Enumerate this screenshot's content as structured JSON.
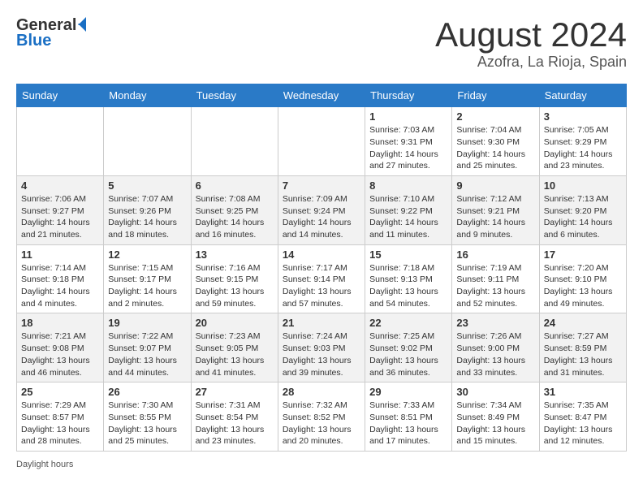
{
  "header": {
    "logo_general": "General",
    "logo_blue": "Blue",
    "month_year": "August 2024",
    "location": "Azofra, La Rioja, Spain"
  },
  "days_of_week": [
    "Sunday",
    "Monday",
    "Tuesday",
    "Wednesday",
    "Thursday",
    "Friday",
    "Saturday"
  ],
  "weeks": [
    [
      {
        "day": "",
        "info": ""
      },
      {
        "day": "",
        "info": ""
      },
      {
        "day": "",
        "info": ""
      },
      {
        "day": "",
        "info": ""
      },
      {
        "day": "1",
        "info": "Sunrise: 7:03 AM\nSunset: 9:31 PM\nDaylight: 14 hours and 27 minutes."
      },
      {
        "day": "2",
        "info": "Sunrise: 7:04 AM\nSunset: 9:30 PM\nDaylight: 14 hours and 25 minutes."
      },
      {
        "day": "3",
        "info": "Sunrise: 7:05 AM\nSunset: 9:29 PM\nDaylight: 14 hours and 23 minutes."
      }
    ],
    [
      {
        "day": "4",
        "info": "Sunrise: 7:06 AM\nSunset: 9:27 PM\nDaylight: 14 hours and 21 minutes."
      },
      {
        "day": "5",
        "info": "Sunrise: 7:07 AM\nSunset: 9:26 PM\nDaylight: 14 hours and 18 minutes."
      },
      {
        "day": "6",
        "info": "Sunrise: 7:08 AM\nSunset: 9:25 PM\nDaylight: 14 hours and 16 minutes."
      },
      {
        "day": "7",
        "info": "Sunrise: 7:09 AM\nSunset: 9:24 PM\nDaylight: 14 hours and 14 minutes."
      },
      {
        "day": "8",
        "info": "Sunrise: 7:10 AM\nSunset: 9:22 PM\nDaylight: 14 hours and 11 minutes."
      },
      {
        "day": "9",
        "info": "Sunrise: 7:12 AM\nSunset: 9:21 PM\nDaylight: 14 hours and 9 minutes."
      },
      {
        "day": "10",
        "info": "Sunrise: 7:13 AM\nSunset: 9:20 PM\nDaylight: 14 hours and 6 minutes."
      }
    ],
    [
      {
        "day": "11",
        "info": "Sunrise: 7:14 AM\nSunset: 9:18 PM\nDaylight: 14 hours and 4 minutes."
      },
      {
        "day": "12",
        "info": "Sunrise: 7:15 AM\nSunset: 9:17 PM\nDaylight: 14 hours and 2 minutes."
      },
      {
        "day": "13",
        "info": "Sunrise: 7:16 AM\nSunset: 9:15 PM\nDaylight: 13 hours and 59 minutes."
      },
      {
        "day": "14",
        "info": "Sunrise: 7:17 AM\nSunset: 9:14 PM\nDaylight: 13 hours and 57 minutes."
      },
      {
        "day": "15",
        "info": "Sunrise: 7:18 AM\nSunset: 9:13 PM\nDaylight: 13 hours and 54 minutes."
      },
      {
        "day": "16",
        "info": "Sunrise: 7:19 AM\nSunset: 9:11 PM\nDaylight: 13 hours and 52 minutes."
      },
      {
        "day": "17",
        "info": "Sunrise: 7:20 AM\nSunset: 9:10 PM\nDaylight: 13 hours and 49 minutes."
      }
    ],
    [
      {
        "day": "18",
        "info": "Sunrise: 7:21 AM\nSunset: 9:08 PM\nDaylight: 13 hours and 46 minutes."
      },
      {
        "day": "19",
        "info": "Sunrise: 7:22 AM\nSunset: 9:07 PM\nDaylight: 13 hours and 44 minutes."
      },
      {
        "day": "20",
        "info": "Sunrise: 7:23 AM\nSunset: 9:05 PM\nDaylight: 13 hours and 41 minutes."
      },
      {
        "day": "21",
        "info": "Sunrise: 7:24 AM\nSunset: 9:03 PM\nDaylight: 13 hours and 39 minutes."
      },
      {
        "day": "22",
        "info": "Sunrise: 7:25 AM\nSunset: 9:02 PM\nDaylight: 13 hours and 36 minutes."
      },
      {
        "day": "23",
        "info": "Sunrise: 7:26 AM\nSunset: 9:00 PM\nDaylight: 13 hours and 33 minutes."
      },
      {
        "day": "24",
        "info": "Sunrise: 7:27 AM\nSunset: 8:59 PM\nDaylight: 13 hours and 31 minutes."
      }
    ],
    [
      {
        "day": "25",
        "info": "Sunrise: 7:29 AM\nSunset: 8:57 PM\nDaylight: 13 hours and 28 minutes."
      },
      {
        "day": "26",
        "info": "Sunrise: 7:30 AM\nSunset: 8:55 PM\nDaylight: 13 hours and 25 minutes."
      },
      {
        "day": "27",
        "info": "Sunrise: 7:31 AM\nSunset: 8:54 PM\nDaylight: 13 hours and 23 minutes."
      },
      {
        "day": "28",
        "info": "Sunrise: 7:32 AM\nSunset: 8:52 PM\nDaylight: 13 hours and 20 minutes."
      },
      {
        "day": "29",
        "info": "Sunrise: 7:33 AM\nSunset: 8:51 PM\nDaylight: 13 hours and 17 minutes."
      },
      {
        "day": "30",
        "info": "Sunrise: 7:34 AM\nSunset: 8:49 PM\nDaylight: 13 hours and 15 minutes."
      },
      {
        "day": "31",
        "info": "Sunrise: 7:35 AM\nSunset: 8:47 PM\nDaylight: 13 hours and 12 minutes."
      }
    ]
  ],
  "footer": {
    "daylight_label": "Daylight hours"
  }
}
